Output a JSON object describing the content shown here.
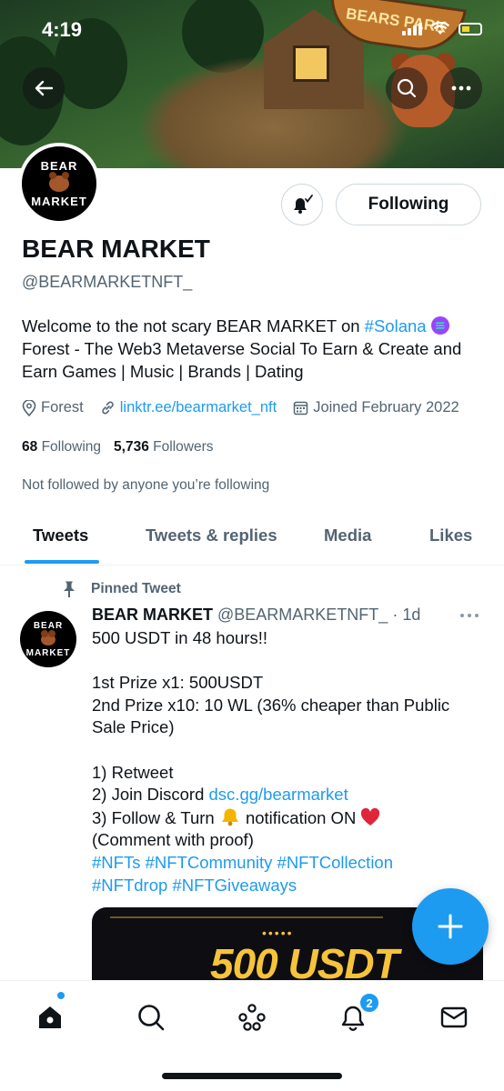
{
  "status_bar": {
    "time": "4:19"
  },
  "banner": {
    "sign_text": "BEARS PARK"
  },
  "profile": {
    "avatar_line1": "BEAR",
    "avatar_line2": "MARKET",
    "following_button": "Following",
    "name": "BEAR MARKET",
    "handle": "@BEARMARKETNFT_",
    "bio_part1": "Welcome to the not scary BEAR MARKET on ",
    "bio_hashtag": "#Solana",
    "bio_part2": "Forest - The Web3 Metaverse Social To Earn & Create and Earn Games | Music | Brands | Dating",
    "location": "Forest",
    "website": "linktr.ee/bearmarket_nft",
    "joined": "Joined February 2022",
    "following_count": "68",
    "following_label": "Following",
    "followers_count": "5,736",
    "followers_label": "Followers",
    "not_followed": "Not followed by anyone you’re following"
  },
  "tabs": [
    {
      "label": "Tweets",
      "active": true
    },
    {
      "label": "Tweets & replies",
      "active": false
    },
    {
      "label": "Media",
      "active": false
    },
    {
      "label": "Likes",
      "active": false
    }
  ],
  "tweet": {
    "pinned_label": "Pinned Tweet",
    "author_name": "BEAR MARKET",
    "author_handle": "@BEARMARKETNFT_",
    "time": "· 1d",
    "line1": "500 USDT in 48 hours!!",
    "line2": "1st Prize x1: 500USDT",
    "line3": "2nd Prize x10: 10 WL (36% cheaper than Public Sale Price)",
    "line4": "1) Retweet",
    "line5_prefix": "2) Join Discord ",
    "line5_link": "dsc.gg/bearmarket",
    "line6_prefix": "3) Follow & Turn ",
    "line6_suffix": " notification ON ",
    "line7": "(Comment with proof)",
    "hashtags1": "#NFTs #NFTCommunity #NFTCollection",
    "hashtags2": "#NFTdrop  #NFTGiveaways",
    "media_dots": "•••••",
    "media_text": "500 USDT"
  },
  "nav": {
    "notifications_badge": "2"
  },
  "colors": {
    "accent": "#1d9bf0",
    "text": "#0f1419",
    "secondary": "#536471"
  }
}
